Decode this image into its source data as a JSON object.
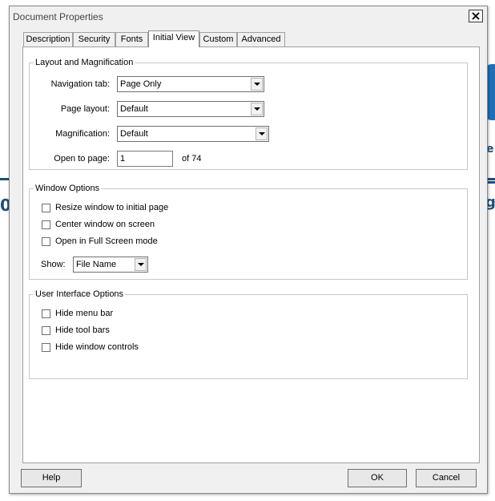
{
  "window": {
    "title": "Document Properties",
    "close_glyph": "✕"
  },
  "tabs": [
    {
      "label": "Description",
      "active": false
    },
    {
      "label": "Security",
      "active": false
    },
    {
      "label": "Fonts",
      "active": false
    },
    {
      "label": "Initial View",
      "active": true
    },
    {
      "label": "Custom",
      "active": false
    },
    {
      "label": "Advanced",
      "active": false
    }
  ],
  "layout_group": {
    "legend": "Layout and Magnification",
    "navigation_tab": {
      "label": "Navigation tab:",
      "value": "Page Only"
    },
    "page_layout": {
      "label": "Page layout:",
      "value": "Default"
    },
    "magnification": {
      "label": "Magnification:",
      "value": "Default"
    },
    "open_to_page": {
      "label": "Open to page:",
      "value": "1",
      "suffix": "of 74"
    }
  },
  "window_group": {
    "legend": "Window Options",
    "resize": {
      "label": "Resize window to initial page",
      "checked": false
    },
    "center": {
      "label": "Center window on screen",
      "checked": false
    },
    "fullscreen": {
      "label": "Open in Full Screen mode",
      "checked": false
    },
    "show": {
      "label": "Show:",
      "value": "File Name"
    }
  },
  "ui_group": {
    "legend": "User Interface Options",
    "hide_menu": {
      "label": "Hide menu bar",
      "checked": false
    },
    "hide_toolbars": {
      "label": "Hide tool bars",
      "checked": false
    },
    "hide_controls": {
      "label": "Hide window controls",
      "checked": false
    }
  },
  "buttons": {
    "help": "Help",
    "ok": "OK",
    "cancel": "Cancel"
  },
  "colors": {
    "dialog_bg": "#f0f0f0",
    "panel_bg": "#ffffff",
    "background_accent": "#1f4e79"
  }
}
